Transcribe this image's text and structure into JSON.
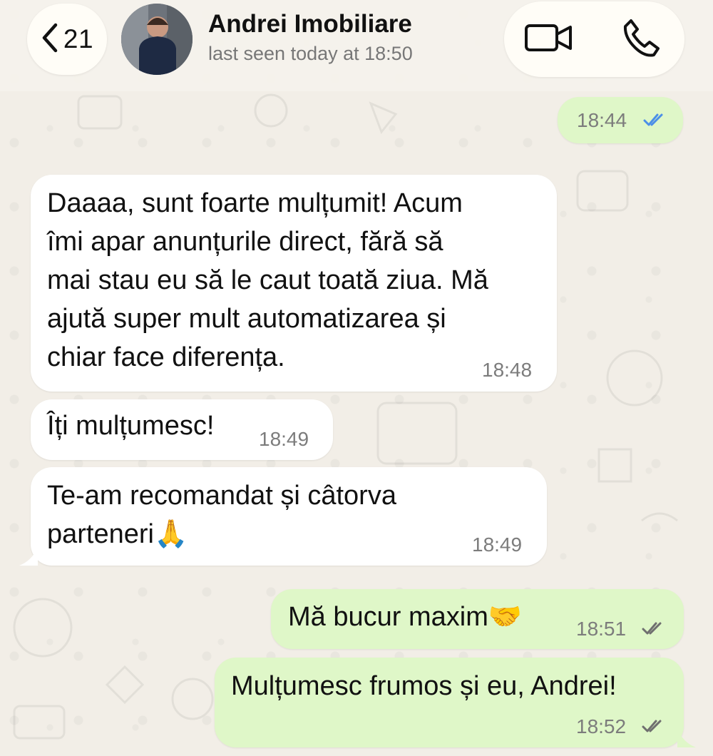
{
  "header": {
    "back_count": "21",
    "contact_name": "Andrei Imobiliare",
    "last_seen": "last seen today at 18:50"
  },
  "messages": [
    {
      "direction": "outgoing",
      "text": "",
      "time": "18:44",
      "read": true
    },
    {
      "direction": "incoming",
      "text": "Daaaa, sunt foarte mulțumit! Acum\nîmi apar anunțurile direct, fără să\nmai stau eu să le caut toată ziua. Mă\najută super mult automatizarea și\nchiar face diferența.",
      "time": "18:48"
    },
    {
      "direction": "incoming",
      "text": "Îți mulțumesc!",
      "time": "18:49"
    },
    {
      "direction": "incoming",
      "text": "Te-am recomandat și câtorva\nparteneri🙏",
      "time": "18:49"
    },
    {
      "direction": "outgoing",
      "text": "Mă bucur maxim🤝",
      "time": "18:51",
      "read": false
    },
    {
      "direction": "outgoing",
      "text": "Mulțumesc frumos și eu, Andrei!",
      "time": "18:52",
      "read": false
    }
  ],
  "colors": {
    "incoming_bubble": "#ffffff",
    "outgoing_bubble": "#dff7c8",
    "read_tick": "#4b8fe8",
    "delivered_tick": "#6f6f6f"
  },
  "icons": {
    "back": "chevron-left-icon",
    "video": "video-camera-icon",
    "call": "phone-icon",
    "read_receipt": "double-check-icon"
  }
}
